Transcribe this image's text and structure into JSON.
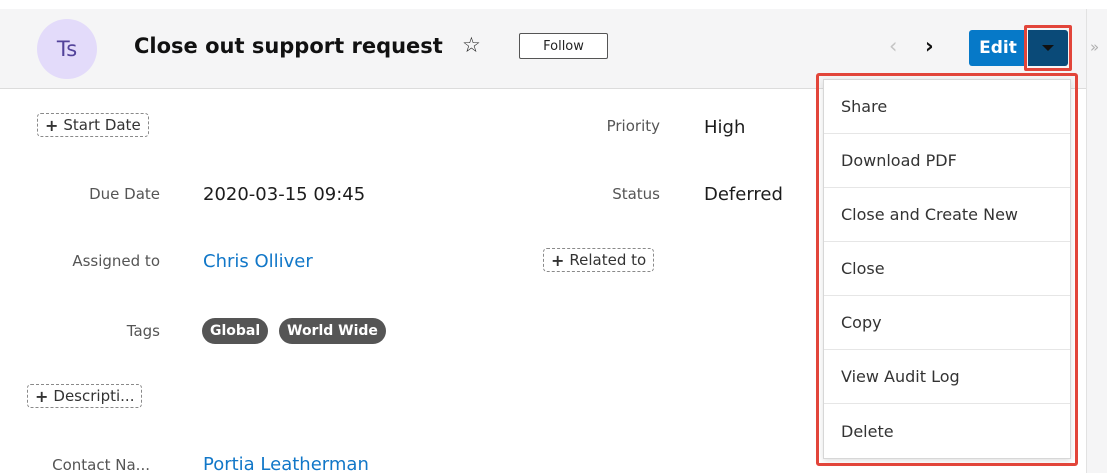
{
  "header": {
    "avatar_initials": "Ts",
    "title": "Close out support request",
    "star_icon": "☆",
    "follow_label": "Follow",
    "prev_icon": "‹",
    "next_icon": "›",
    "edit_label": "Edit",
    "rail_icon": "»"
  },
  "fields": {
    "start_date_add": "Start Date",
    "priority_label": "Priority",
    "priority_value": "High",
    "due_date_label": "Due Date",
    "due_date_value": "2020-03-15 09:45",
    "status_label": "Status",
    "status_value": "Deferred",
    "assigned_label": "Assigned to",
    "assigned_value": "Chris Olliver",
    "related_add": "Related to",
    "tags_label": "Tags",
    "tags": [
      "Global",
      "World Wide"
    ],
    "description_add": "Descripti...",
    "contact_label": "Contact Na...",
    "contact_value": "Portia Leatherman"
  },
  "menu": {
    "items": [
      "Share",
      "Download PDF",
      "Close and Create New",
      "Close",
      "Copy",
      "View Audit Log",
      "Delete"
    ]
  },
  "colors": {
    "accent": "#0679c8",
    "highlight": "#e2453a",
    "link": "#1177c8",
    "tag_bg": "#555555"
  }
}
